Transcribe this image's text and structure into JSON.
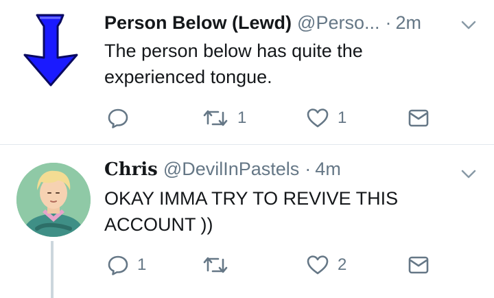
{
  "tweets": [
    {
      "display_name": "Person Below (Lewd)",
      "handle": "@Perso...",
      "time": "2m",
      "text": "The person below has quite the experienced tongue.",
      "reply_count": "",
      "retweet_count": "1",
      "like_count": "1",
      "avatar": "blue-down-arrow"
    },
    {
      "display_name": "Chris",
      "handle": "@DevilInPastels",
      "time": "4m",
      "text": "OKAY IMMA TRY TO REVIVE THIS ACCOUNT ))",
      "reply_count": "1",
      "retweet_count": "",
      "like_count": "2",
      "avatar": "illustrated-person"
    }
  ],
  "separator": "·",
  "colors": {
    "text_primary": "#14171a",
    "text_secondary": "#657786",
    "divider": "#e1e8ed",
    "thread_line": "#ccd6dd",
    "arrow_blue": "#1a1aff"
  },
  "icons": [
    "chevron-down-icon",
    "reply-icon",
    "retweet-icon",
    "like-icon",
    "direct-message-icon"
  ]
}
